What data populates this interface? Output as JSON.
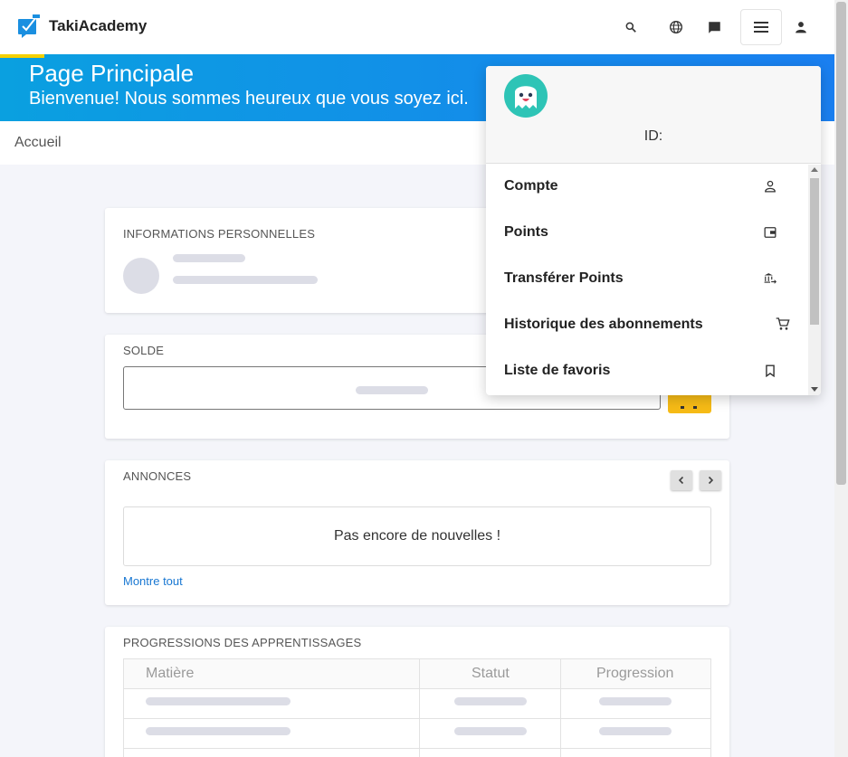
{
  "header": {
    "brand": "TakiAcademy",
    "icons": [
      "search-icon",
      "globe-icon",
      "chat-icon",
      "menu-icon",
      "account-icon"
    ]
  },
  "banner": {
    "title": "Page Principale",
    "subtitle": "Bienvenue! Nous sommes heureux que vous soyez ici."
  },
  "breadcrumb": {
    "current": "Accueil"
  },
  "cards": {
    "info": {
      "heading": "INFORMATIONS PERSONNELLES"
    },
    "solde": {
      "heading": "SOLDE"
    },
    "annonces": {
      "heading": "ANNONCES",
      "empty_message": "Pas encore de nouvelles !",
      "show_all": "Montre tout"
    },
    "progress": {
      "heading": "PROGRESSIONS DES APPRENTISSAGES",
      "columns": [
        "Matière",
        "Statut",
        "Progression"
      ]
    }
  },
  "user_menu": {
    "id_label": "ID:",
    "items": [
      {
        "label": "Compte",
        "icon": "account-outline-icon"
      },
      {
        "label": "Points",
        "icon": "wallet-icon"
      },
      {
        "label": "Transférer Points",
        "icon": "bank-transfer-icon"
      },
      {
        "label": "Historique des abonnements",
        "icon": "cart-icon"
      },
      {
        "label": "Liste de favoris",
        "icon": "bookmark-icon"
      }
    ]
  },
  "colors": {
    "banner_start": "#0aa0e0",
    "banner_end": "#1a7ff0",
    "accent_yellow": "#f6bb16",
    "link_blue": "#1877d2",
    "mascot_teal": "#2ec4b6"
  }
}
